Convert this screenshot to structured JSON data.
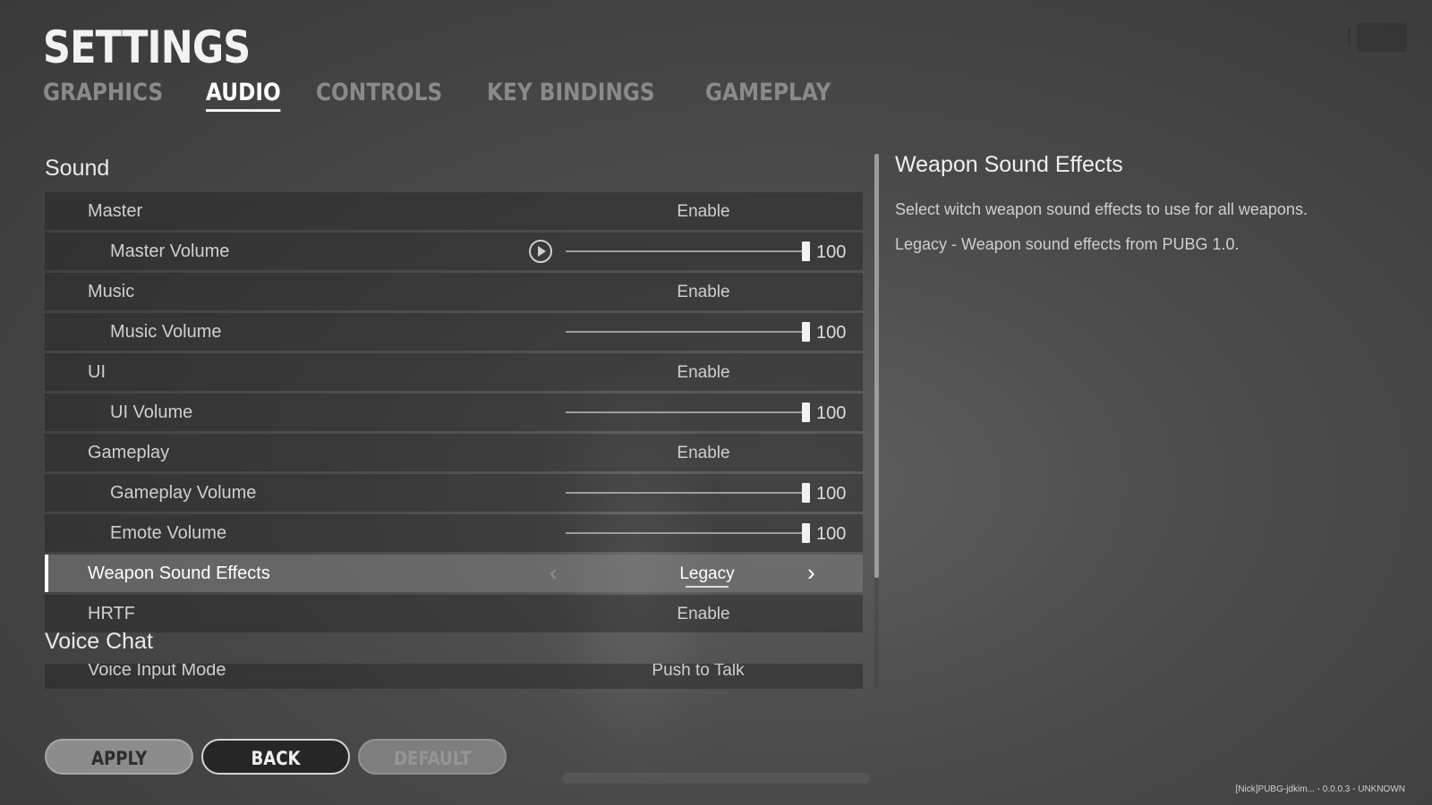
{
  "page": {
    "title": "SETTINGS",
    "version_text": "[Nick]PUBG-jdkim... - 0.0.0.3 - UNKNOWN"
  },
  "tabs": [
    {
      "label": "GRAPHICS",
      "active": false
    },
    {
      "label": "AUDIO",
      "active": true
    },
    {
      "label": "CONTROLS",
      "active": false
    },
    {
      "label": "KEY BINDINGS",
      "active": false
    },
    {
      "label": "GAMEPLAY",
      "active": false
    }
  ],
  "sound": {
    "section_title": "Sound",
    "rows": {
      "master": {
        "label": "Master",
        "value": "Enable"
      },
      "master_volume": {
        "label": "Master Volume",
        "value": "100"
      },
      "music": {
        "label": "Music",
        "value": "Enable"
      },
      "music_volume": {
        "label": "Music Volume",
        "value": "100"
      },
      "ui": {
        "label": "UI",
        "value": "Enable"
      },
      "ui_volume": {
        "label": "UI Volume",
        "value": "100"
      },
      "gameplay": {
        "label": "Gameplay",
        "value": "Enable"
      },
      "gameplay_volume": {
        "label": "Gameplay Volume",
        "value": "100"
      },
      "emote_volume": {
        "label": "Emote Volume",
        "value": "100"
      },
      "weapon_sound_effects": {
        "label": "Weapon Sound Effects",
        "value": "Legacy"
      },
      "hrtf": {
        "label": "HRTF",
        "value": "Enable"
      }
    }
  },
  "voice_chat": {
    "section_title": "Voice Chat",
    "partial_row": {
      "label": "Voice Input Mode",
      "value": "Push to Talk"
    }
  },
  "description": {
    "title": "Weapon Sound Effects",
    "line1": "Select witch weapon sound effects to use for all weapons.",
    "line2": "Legacy - Weapon sound effects from PUBG 1.0."
  },
  "buttons": {
    "apply": "APPLY",
    "back": "BACK",
    "default": "DEFAULT"
  },
  "icons": {
    "play": "play-icon",
    "arrow_left": "chevron-left-icon",
    "arrow_right": "chevron-right-icon"
  }
}
